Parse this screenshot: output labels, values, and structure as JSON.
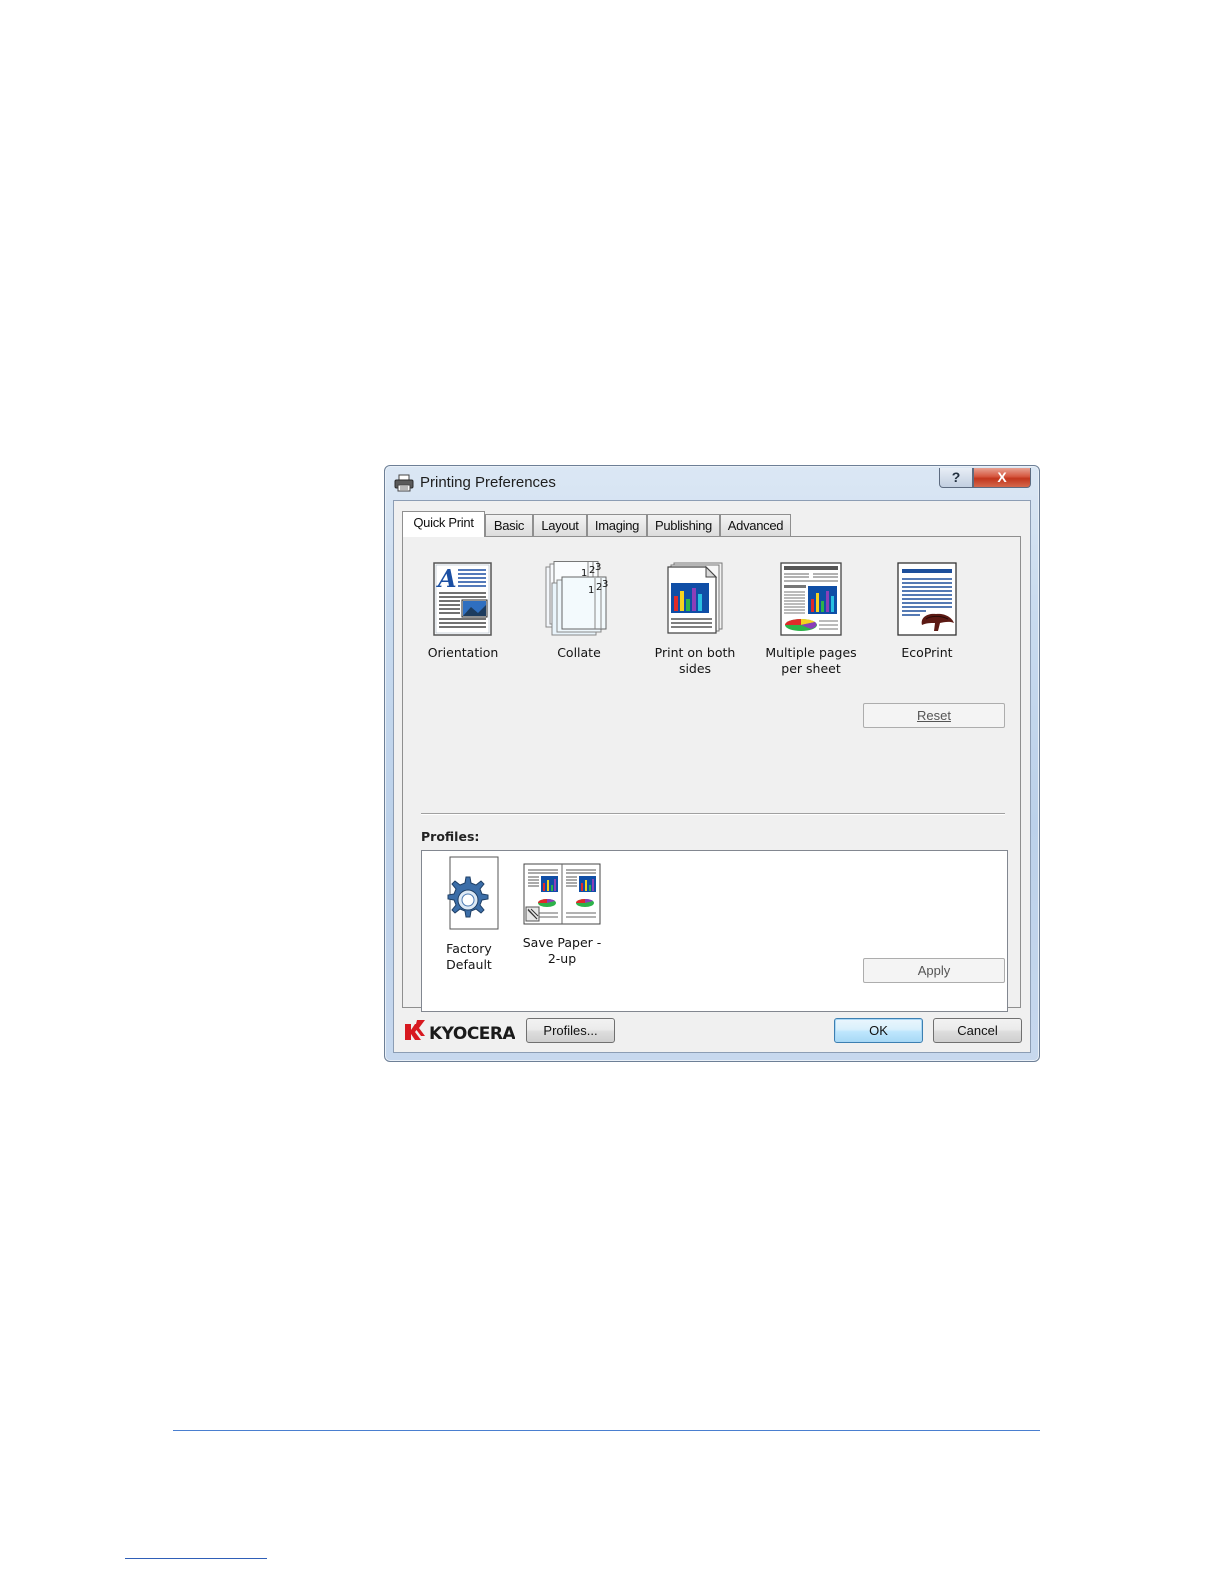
{
  "window": {
    "title": "Printing Preferences",
    "help_label": "?",
    "close_label": "X"
  },
  "tabs": [
    {
      "label": "Quick Print",
      "active": true
    },
    {
      "label": "Basic"
    },
    {
      "label": "Layout"
    },
    {
      "label": "Imaging"
    },
    {
      "label": "Publishing"
    },
    {
      "label": "Advanced"
    }
  ],
  "quick_print": {
    "items": [
      {
        "icon": "orientation-icon",
        "label_line1": "Orientation",
        "label_line2": ""
      },
      {
        "icon": "collate-icon",
        "label_line1": "Collate",
        "label_line2": ""
      },
      {
        "icon": "duplex-icon",
        "label_line1": "Print on both",
        "label_line2": "sides"
      },
      {
        "icon": "multiple-pages-icon",
        "label_line1": "Multiple pages",
        "label_line2": "per sheet"
      },
      {
        "icon": "ecoprint-icon",
        "label_line1": "EcoPrint",
        "label_line2": ""
      }
    ],
    "collate_numbers": [
      "1",
      "2",
      "3"
    ],
    "reset_label": "Reset"
  },
  "profiles": {
    "label": "Profiles:",
    "items": [
      {
        "icon": "factory-default-gear-icon",
        "label_line1": "Factory",
        "label_line2": "Default"
      },
      {
        "icon": "save-paper-2up-icon",
        "label_line1": "Save Paper -",
        "label_line2": "2-up"
      }
    ],
    "apply_label": "Apply"
  },
  "footer": {
    "brand": "KYOCERA",
    "profiles_button": "Profiles...",
    "ok_label": "OK",
    "cancel_label": "Cancel"
  },
  "colors": {
    "title_bar": "#c9dbef",
    "close_button": "#c2361d",
    "brand_red": "#d71920",
    "ok_border": "#3c7fb1",
    "rule": "#4a7fd0"
  }
}
